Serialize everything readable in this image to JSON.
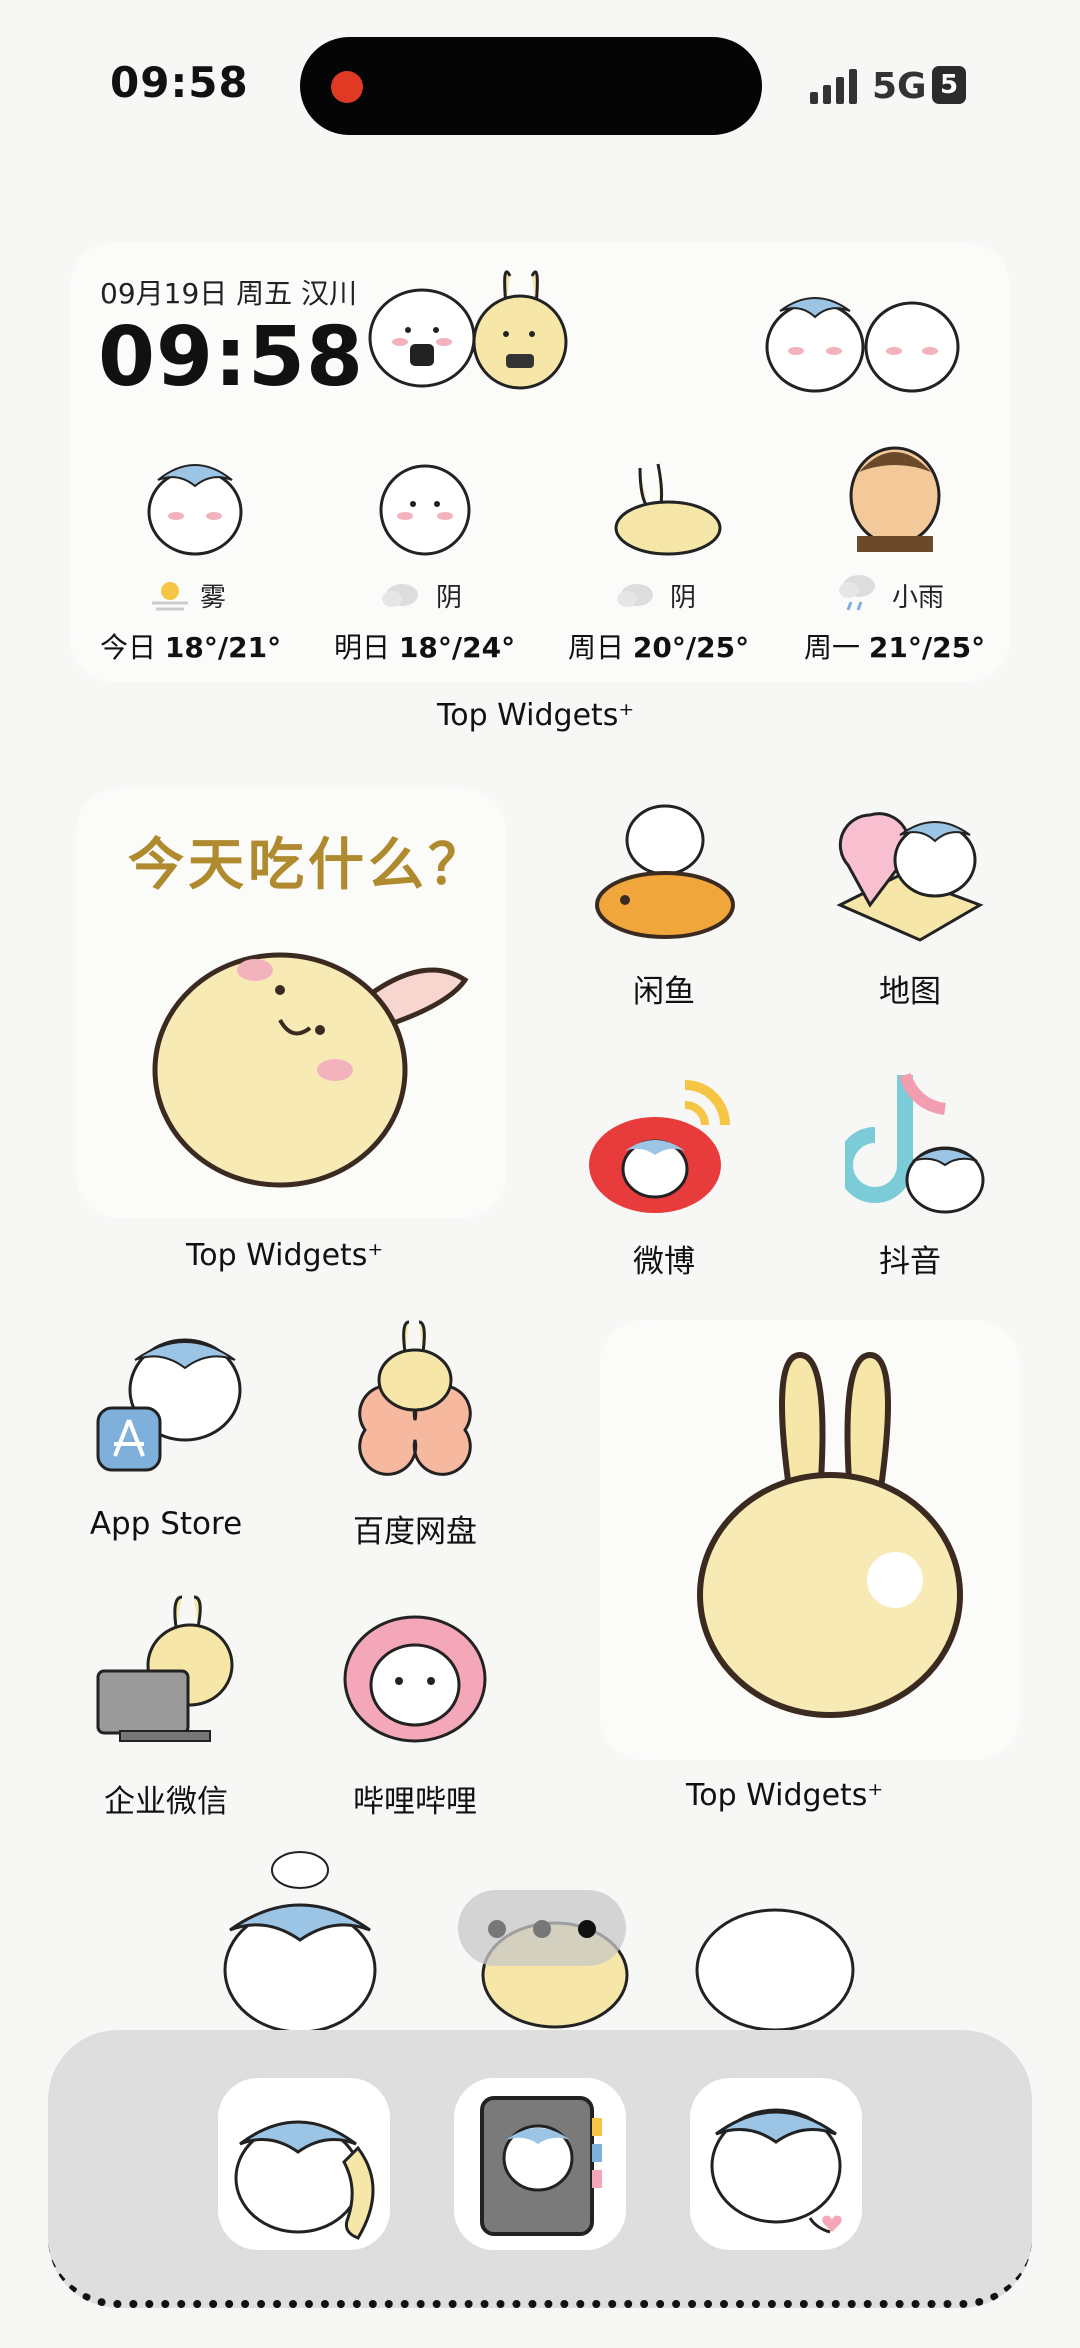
{
  "status_bar": {
    "time": "09:58",
    "network": "5G",
    "battery": "5"
  },
  "clock_widget": {
    "date": "09月19日 周五 汉川",
    "time": "09:58",
    "forecast": [
      {
        "day": "今日",
        "temp": "18°/21°",
        "condition": "雾",
        "icon": "sun-fog-icon"
      },
      {
        "day": "明日",
        "temp": "18°/24°",
        "condition": "阴",
        "icon": "cloud-icon"
      },
      {
        "day": "周日",
        "temp": "20°/25°",
        "condition": "阴",
        "icon": "cloud-icon"
      },
      {
        "day": "周一",
        "temp": "21°/25°",
        "condition": "小雨",
        "icon": "rain-cloud-icon"
      }
    ],
    "label": "Top Widgets⁺"
  },
  "food_widget": {
    "title": "今天吃什么？",
    "label": "Top Widgets⁺"
  },
  "apps_row1": [
    {
      "label": "闲鱼"
    },
    {
      "label": "地图"
    },
    {
      "label": "微博"
    },
    {
      "label": "抖音"
    }
  ],
  "apps_row2": [
    {
      "label": "App Store"
    },
    {
      "label": "百度网盘"
    },
    {
      "label": "企业微信"
    },
    {
      "label": "哔哩哔哩"
    }
  ],
  "bunny_widget": {
    "label": "Top Widgets⁺"
  },
  "dock": [
    {
      "name": "phone",
      "icon": "phone-icon"
    },
    {
      "name": "contacts",
      "icon": "contacts-book-icon"
    },
    {
      "name": "messages",
      "icon": "speech-bubble-icon"
    }
  ],
  "colors": {
    "accent_red": "#e03a24",
    "cream": "#f6e7a9",
    "blue_hat": "#9cc4e4"
  }
}
